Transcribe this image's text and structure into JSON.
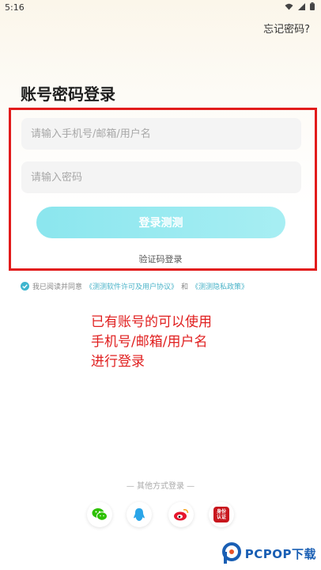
{
  "status_bar": {
    "time": "5:16"
  },
  "header": {
    "forgot_password": "忘记密码?"
  },
  "title": "账号密码登录",
  "form": {
    "account_placeholder": "请输入手机号/邮箱/用户名",
    "password_placeholder": "请输入密码",
    "login_button": "登录测测",
    "sms_login": "验证码登录"
  },
  "agreement": {
    "prefix": "我已阅读并同意",
    "software_license": "《测测软件许可及用户协议》",
    "and": "和",
    "privacy_policy": "《测测隐私政策》"
  },
  "annotation": {
    "line1": "已有账号的可以使用",
    "line2": "手机号/邮箱/用户名",
    "line3": "进行登录"
  },
  "other_methods": {
    "label": "— 其他方式登录 —"
  },
  "social": {
    "icons": [
      "wechat-icon",
      "qq-icon",
      "weibo-icon",
      "id-card-icon"
    ],
    "idcard_text_1": "身份",
    "idcard_text_2": "认证"
  },
  "watermark": {
    "text": "PCPOP下载"
  },
  "colors": {
    "accent": "#8be6ee",
    "annotation_red": "#e01f1f",
    "link": "#4ab3c8"
  }
}
